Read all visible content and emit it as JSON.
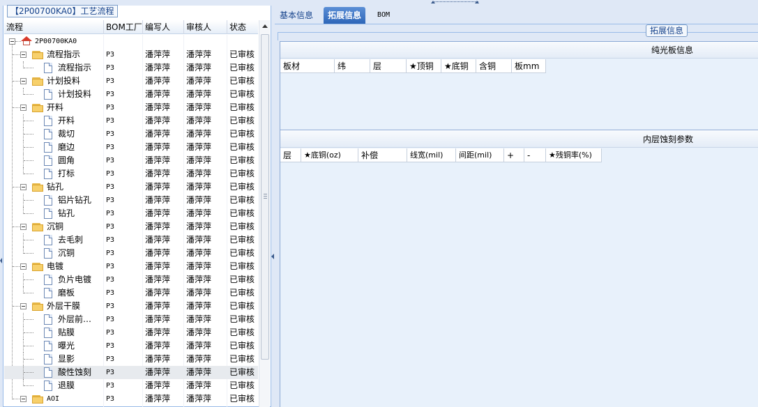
{
  "left_panel": {
    "caption": "【2P00700KA0】工艺流程",
    "columns": [
      "流程",
      "BOM工厂",
      "编写人",
      "审核人",
      "状态"
    ],
    "root_label": "2P00700KA0",
    "rows": [
      {
        "label": "流程指示",
        "type": "folder",
        "level": 1,
        "bom": "P3",
        "writer": "潘萍萍",
        "reviewer": "潘萍萍",
        "status": "已审核"
      },
      {
        "label": "流程指示",
        "type": "doc",
        "level": 2,
        "bom": "P3",
        "writer": "潘萍萍",
        "reviewer": "潘萍萍",
        "status": "已审核"
      },
      {
        "label": "计划投料",
        "type": "folder",
        "level": 1,
        "bom": "P3",
        "writer": "潘萍萍",
        "reviewer": "潘萍萍",
        "status": "已审核"
      },
      {
        "label": "计划投料",
        "type": "doc",
        "level": 2,
        "bom": "P3",
        "writer": "潘萍萍",
        "reviewer": "潘萍萍",
        "status": "已审核"
      },
      {
        "label": "开料",
        "type": "folder",
        "level": 1,
        "bom": "P3",
        "writer": "潘萍萍",
        "reviewer": "潘萍萍",
        "status": "已审核"
      },
      {
        "label": "开料",
        "type": "doc",
        "level": 2,
        "bom": "P3",
        "writer": "潘萍萍",
        "reviewer": "潘萍萍",
        "status": "已审核"
      },
      {
        "label": "裁切",
        "type": "doc",
        "level": 2,
        "bom": "P3",
        "writer": "潘萍萍",
        "reviewer": "潘萍萍",
        "status": "已审核"
      },
      {
        "label": "磨边",
        "type": "doc",
        "level": 2,
        "bom": "P3",
        "writer": "潘萍萍",
        "reviewer": "潘萍萍",
        "status": "已审核"
      },
      {
        "label": "圆角",
        "type": "doc",
        "level": 2,
        "bom": "P3",
        "writer": "潘萍萍",
        "reviewer": "潘萍萍",
        "status": "已审核"
      },
      {
        "label": "打标",
        "type": "doc",
        "level": 2,
        "bom": "P3",
        "writer": "潘萍萍",
        "reviewer": "潘萍萍",
        "status": "已审核"
      },
      {
        "label": "钻孔",
        "type": "folder",
        "level": 1,
        "bom": "P3",
        "writer": "潘萍萍",
        "reviewer": "潘萍萍",
        "status": "已审核"
      },
      {
        "label": "铝片钻孔",
        "type": "doc",
        "level": 2,
        "bom": "P3",
        "writer": "潘萍萍",
        "reviewer": "潘萍萍",
        "status": "已审核"
      },
      {
        "label": "钻孔",
        "type": "doc",
        "level": 2,
        "bom": "P3",
        "writer": "潘萍萍",
        "reviewer": "潘萍萍",
        "status": "已审核"
      },
      {
        "label": "沉铜",
        "type": "folder",
        "level": 1,
        "bom": "P3",
        "writer": "潘萍萍",
        "reviewer": "潘萍萍",
        "status": "已审核"
      },
      {
        "label": "去毛刺",
        "type": "doc",
        "level": 2,
        "bom": "P3",
        "writer": "潘萍萍",
        "reviewer": "潘萍萍",
        "status": "已审核"
      },
      {
        "label": "沉铜",
        "type": "doc",
        "level": 2,
        "bom": "P3",
        "writer": "潘萍萍",
        "reviewer": "潘萍萍",
        "status": "已审核"
      },
      {
        "label": "电镀",
        "type": "folder",
        "level": 1,
        "bom": "P3",
        "writer": "潘萍萍",
        "reviewer": "潘萍萍",
        "status": "已审核"
      },
      {
        "label": "负片电镀",
        "type": "doc",
        "level": 2,
        "bom": "P3",
        "writer": "潘萍萍",
        "reviewer": "潘萍萍",
        "status": "已审核"
      },
      {
        "label": "磨板",
        "type": "doc",
        "level": 2,
        "bom": "P3",
        "writer": "潘萍萍",
        "reviewer": "潘萍萍",
        "status": "已审核"
      },
      {
        "label": "外层干膜",
        "type": "folder",
        "level": 1,
        "bom": "P3",
        "writer": "潘萍萍",
        "reviewer": "潘萍萍",
        "status": "已审核"
      },
      {
        "label": "外层前…",
        "type": "doc",
        "level": 2,
        "bom": "P3",
        "writer": "潘萍萍",
        "reviewer": "潘萍萍",
        "status": "已审核"
      },
      {
        "label": "贴膜",
        "type": "doc",
        "level": 2,
        "bom": "P3",
        "writer": "潘萍萍",
        "reviewer": "潘萍萍",
        "status": "已审核"
      },
      {
        "label": "曝光",
        "type": "doc",
        "level": 2,
        "bom": "P3",
        "writer": "潘萍萍",
        "reviewer": "潘萍萍",
        "status": "已审核"
      },
      {
        "label": "显影",
        "type": "doc",
        "level": 2,
        "bom": "P3",
        "writer": "潘萍萍",
        "reviewer": "潘萍萍",
        "status": "已审核"
      },
      {
        "label": "酸性蚀刻",
        "type": "doc",
        "level": 2,
        "bom": "P3",
        "writer": "潘萍萍",
        "reviewer": "潘萍萍",
        "status": "已审核",
        "selected": true
      },
      {
        "label": "退膜",
        "type": "doc",
        "level": 2,
        "bom": "P3",
        "writer": "潘萍萍",
        "reviewer": "潘萍萍",
        "status": "已审核"
      },
      {
        "label": "AOI",
        "type": "folder",
        "level": 1,
        "bom": "P3",
        "writer": "潘萍萍",
        "reviewer": "潘萍萍",
        "status": "已审核"
      }
    ]
  },
  "right_panel": {
    "tabs": [
      "基本信息",
      "拓展信息",
      "BOM"
    ],
    "active_tab": "拓展信息",
    "legend": "拓展信息",
    "section1": {
      "title": "纯光板信息",
      "headers": [
        "板材",
        "纬",
        "层",
        "★顶铜",
        "★底铜",
        "含铜",
        "板mm"
      ]
    },
    "section2": {
      "title": "内层蚀刻参数",
      "headers": [
        "层",
        "★底铜(oz)",
        "补偿",
        "线宽(mil)",
        "间距(mil)",
        "+",
        "-",
        "★残铜率(%)"
      ]
    }
  },
  "colors": {
    "panel_bg": "#dfe8f6",
    "border": "#99bbe8",
    "active_tab": "#2e66b8",
    "section_bg": "#e8f1fb",
    "selected_row": "#e7eaee"
  }
}
